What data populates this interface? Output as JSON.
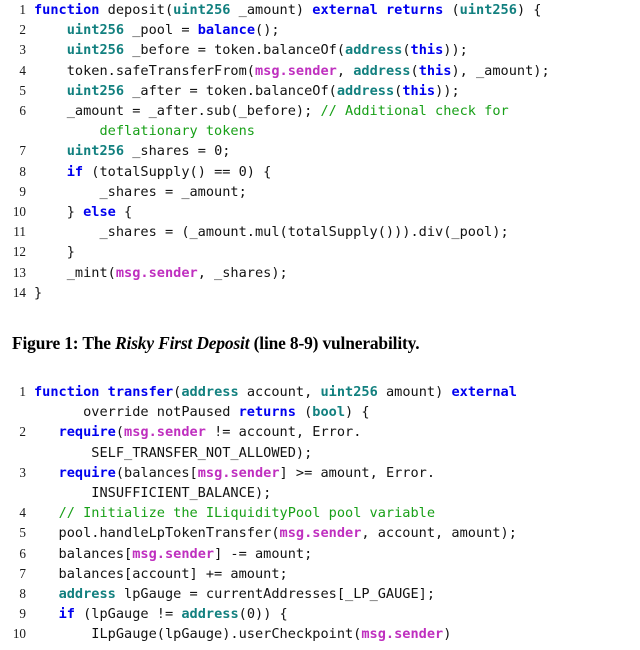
{
  "figure": {
    "caption": {
      "prefix": "Figure 1: The ",
      "emphasis": "Risky First Deposit",
      "suffix": " (line 8-9) vulnerability."
    }
  },
  "listing1": {
    "language": "Solidity",
    "lines": [
      {
        "number": "1",
        "tokens": [
          {
            "t": "function",
            "c": "k"
          },
          {
            "t": " deposit(",
            "c": "p"
          },
          {
            "t": "uint256",
            "c": "t"
          },
          {
            "t": " _amount) ",
            "c": "p"
          },
          {
            "t": "external",
            "c": "k"
          },
          {
            "t": " ",
            "c": "p"
          },
          {
            "t": "returns",
            "c": "k"
          },
          {
            "t": " (",
            "c": "p"
          },
          {
            "t": "uint256",
            "c": "t"
          },
          {
            "t": ") {",
            "c": "p"
          }
        ]
      },
      {
        "number": "2",
        "tokens": [
          {
            "t": "    ",
            "c": "p"
          },
          {
            "t": "uint256",
            "c": "t"
          },
          {
            "t": " _pool = ",
            "c": "p"
          },
          {
            "t": "balance",
            "c": "k"
          },
          {
            "t": "();",
            "c": "p"
          }
        ]
      },
      {
        "number": "3",
        "tokens": [
          {
            "t": "    ",
            "c": "p"
          },
          {
            "t": "uint256",
            "c": "t"
          },
          {
            "t": " _before = token.balanceOf(",
            "c": "p"
          },
          {
            "t": "address",
            "c": "t"
          },
          {
            "t": "(",
            "c": "p"
          },
          {
            "t": "this",
            "c": "k"
          },
          {
            "t": "));",
            "c": "p"
          }
        ]
      },
      {
        "number": "4",
        "tokens": [
          {
            "t": "    token.safeTransferFrom(",
            "c": "p"
          },
          {
            "t": "msg.sender",
            "c": "m"
          },
          {
            "t": ", ",
            "c": "p"
          },
          {
            "t": "address",
            "c": "t"
          },
          {
            "t": "(",
            "c": "p"
          },
          {
            "t": "this",
            "c": "k"
          },
          {
            "t": "), _amount);",
            "c": "p"
          }
        ]
      },
      {
        "number": "5",
        "tokens": [
          {
            "t": "    ",
            "c": "p"
          },
          {
            "t": "uint256",
            "c": "t"
          },
          {
            "t": " _after = token.balanceOf(",
            "c": "p"
          },
          {
            "t": "address",
            "c": "t"
          },
          {
            "t": "(",
            "c": "p"
          },
          {
            "t": "this",
            "c": "k"
          },
          {
            "t": "));",
            "c": "p"
          }
        ]
      },
      {
        "number": "6",
        "tokens": [
          {
            "t": "    _amount = _after.sub(_before); ",
            "c": "p"
          },
          {
            "t": "// Additional check for",
            "c": "c"
          }
        ]
      },
      {
        "number": "",
        "cont": true,
        "tokens": [
          {
            "t": "        ",
            "c": "p"
          },
          {
            "t": "deflationary tokens",
            "c": "c"
          }
        ]
      },
      {
        "number": "7",
        "tokens": [
          {
            "t": "    ",
            "c": "p"
          },
          {
            "t": "uint256",
            "c": "t"
          },
          {
            "t": " _shares = 0;",
            "c": "p"
          }
        ]
      },
      {
        "number": "8",
        "tokens": [
          {
            "t": "    ",
            "c": "p"
          },
          {
            "t": "if",
            "c": "k"
          },
          {
            "t": " (totalSupply() == 0) {",
            "c": "p"
          }
        ]
      },
      {
        "number": "9",
        "tokens": [
          {
            "t": "        _shares = _amount;",
            "c": "p"
          }
        ]
      },
      {
        "number": "10",
        "tokens": [
          {
            "t": "    } ",
            "c": "p"
          },
          {
            "t": "else",
            "c": "k"
          },
          {
            "t": " {",
            "c": "p"
          }
        ]
      },
      {
        "number": "11",
        "tokens": [
          {
            "t": "        _shares = (_amount.mul(totalSupply())).div(_pool);",
            "c": "p"
          }
        ]
      },
      {
        "number": "12",
        "tokens": [
          {
            "t": "    }",
            "c": "p"
          }
        ]
      },
      {
        "number": "13",
        "tokens": [
          {
            "t": "    _mint(",
            "c": "p"
          },
          {
            "t": "msg.sender",
            "c": "m"
          },
          {
            "t": ", _shares);",
            "c": "p"
          }
        ]
      },
      {
        "number": "14",
        "tokens": [
          {
            "t": "}",
            "c": "p"
          }
        ]
      }
    ]
  },
  "listing2": {
    "language": "Solidity",
    "lines": [
      {
        "number": "1",
        "tokens": [
          {
            "t": "function",
            "c": "k"
          },
          {
            "t": " ",
            "c": "p"
          },
          {
            "t": "transfer",
            "c": "k"
          },
          {
            "t": "(",
            "c": "p"
          },
          {
            "t": "address",
            "c": "t"
          },
          {
            "t": " account, ",
            "c": "p"
          },
          {
            "t": "uint256",
            "c": "t"
          },
          {
            "t": " amount) ",
            "c": "p"
          },
          {
            "t": "external",
            "c": "k"
          }
        ]
      },
      {
        "number": "",
        "cont": true,
        "tokens": [
          {
            "t": "      override notPaused ",
            "c": "p"
          },
          {
            "t": "returns",
            "c": "k"
          },
          {
            "t": " (",
            "c": "p"
          },
          {
            "t": "bool",
            "c": "t"
          },
          {
            "t": ") {",
            "c": "p"
          }
        ]
      },
      {
        "number": "2",
        "tokens": [
          {
            "t": "   ",
            "c": "p"
          },
          {
            "t": "require",
            "c": "k"
          },
          {
            "t": "(",
            "c": "p"
          },
          {
            "t": "msg.sender",
            "c": "m"
          },
          {
            "t": " != account, Error.",
            "c": "p"
          }
        ]
      },
      {
        "number": "",
        "cont": true,
        "tokens": [
          {
            "t": "       SELF_TRANSFER_NOT_ALLOWED);",
            "c": "p"
          }
        ]
      },
      {
        "number": "3",
        "tokens": [
          {
            "t": "   ",
            "c": "p"
          },
          {
            "t": "require",
            "c": "k"
          },
          {
            "t": "(balances[",
            "c": "p"
          },
          {
            "t": "msg.sender",
            "c": "m"
          },
          {
            "t": "] >= amount, Error.",
            "c": "p"
          }
        ]
      },
      {
        "number": "",
        "cont": true,
        "tokens": [
          {
            "t": "       INSUFFICIENT_BALANCE);",
            "c": "p"
          }
        ]
      },
      {
        "number": "4",
        "tokens": [
          {
            "t": "   ",
            "c": "p"
          },
          {
            "t": "// Initialize the ILiquidityPool pool variable",
            "c": "c"
          }
        ]
      },
      {
        "number": "5",
        "tokens": [
          {
            "t": "   pool.handleLpTokenTransfer(",
            "c": "p"
          },
          {
            "t": "msg.sender",
            "c": "m"
          },
          {
            "t": ", account, amount);",
            "c": "p"
          }
        ]
      },
      {
        "number": "6",
        "tokens": [
          {
            "t": "   balances[",
            "c": "p"
          },
          {
            "t": "msg.sender",
            "c": "m"
          },
          {
            "t": "] -= amount;",
            "c": "p"
          }
        ]
      },
      {
        "number": "7",
        "tokens": [
          {
            "t": "   balances[account] += amount;",
            "c": "p"
          }
        ]
      },
      {
        "number": "8",
        "tokens": [
          {
            "t": "   ",
            "c": "p"
          },
          {
            "t": "address",
            "c": "t"
          },
          {
            "t": " lpGauge = currentAddresses[_LP_GAUGE];",
            "c": "p"
          }
        ]
      },
      {
        "number": "9",
        "tokens": [
          {
            "t": "   ",
            "c": "p"
          },
          {
            "t": "if",
            "c": "k"
          },
          {
            "t": " (lpGauge != ",
            "c": "p"
          },
          {
            "t": "address",
            "c": "t"
          },
          {
            "t": "(0)) {",
            "c": "p"
          }
        ]
      },
      {
        "number": "10",
        "tokens": [
          {
            "t": "       ILpGauge(lpGauge).userCheckpoint(",
            "c": "p"
          },
          {
            "t": "msg.sender",
            "c": "m"
          },
          {
            "t": ")",
            "c": "p"
          }
        ]
      }
    ]
  }
}
